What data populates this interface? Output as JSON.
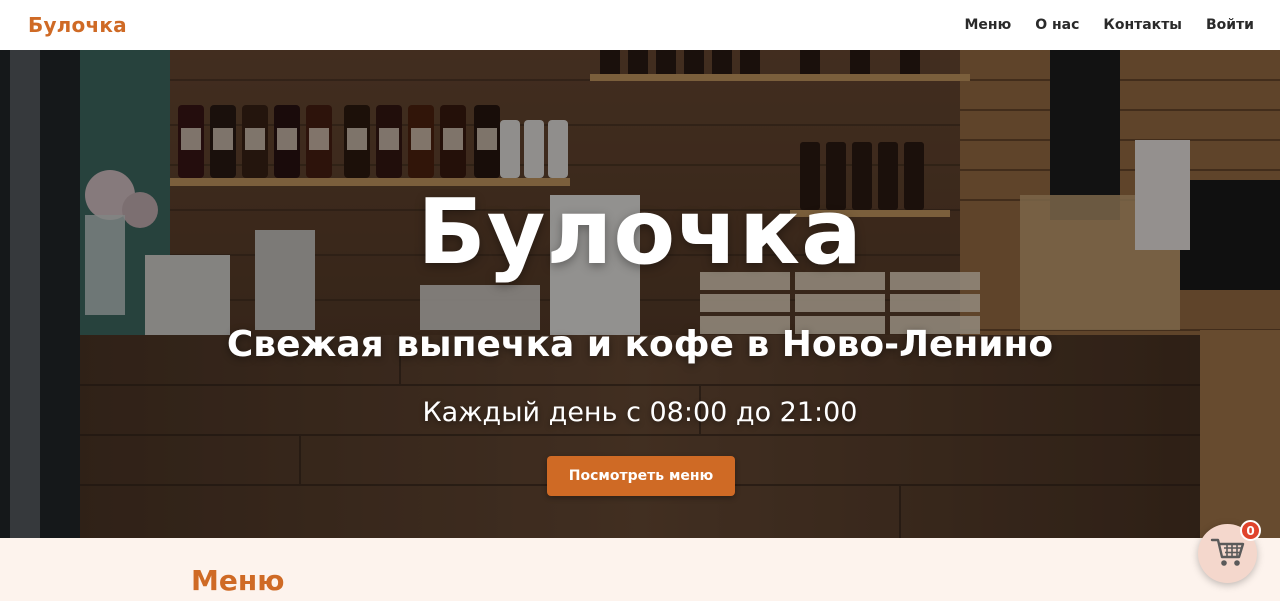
{
  "header": {
    "logo": "Булочка",
    "nav": [
      {
        "label": "Меню"
      },
      {
        "label": "О нас"
      },
      {
        "label": "Контакты"
      },
      {
        "label": "Войти"
      }
    ]
  },
  "hero": {
    "title": "Булочка",
    "subtitle": "Свежая выпечка и кофе в Ново-Ленино",
    "hours": "Каждый день с 08:00 до 21:00",
    "button_label": "Посмотреть меню"
  },
  "menu_section": {
    "heading": "Меню"
  },
  "cart": {
    "count": "0",
    "icon": "shopping-cart-icon"
  },
  "colors": {
    "accent": "#cf6a25",
    "badge": "#e0442d",
    "section_bg": "#fdf3ed"
  }
}
